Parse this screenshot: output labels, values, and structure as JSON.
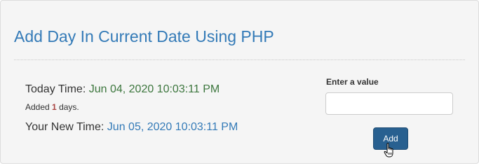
{
  "title": "Add Day In Current Date Using PHP",
  "today": {
    "label": "Today Time:",
    "value": "Jun 04, 2020 10:03:11 PM"
  },
  "added": {
    "prefix": "Added",
    "count": "1",
    "suffix": "days."
  },
  "new_time": {
    "label": "Your New Time:",
    "value": "Jun 05, 2020 10:03:11 PM"
  },
  "form": {
    "label": "Enter a value",
    "input_value": "",
    "button_label": "Add"
  },
  "icons": {
    "cursor": "hand-pointer-icon"
  },
  "colors": {
    "title": "#337ab7",
    "today_value": "#3c763d",
    "new_value": "#337ab7",
    "count": "#a94442",
    "button": "#286090"
  }
}
